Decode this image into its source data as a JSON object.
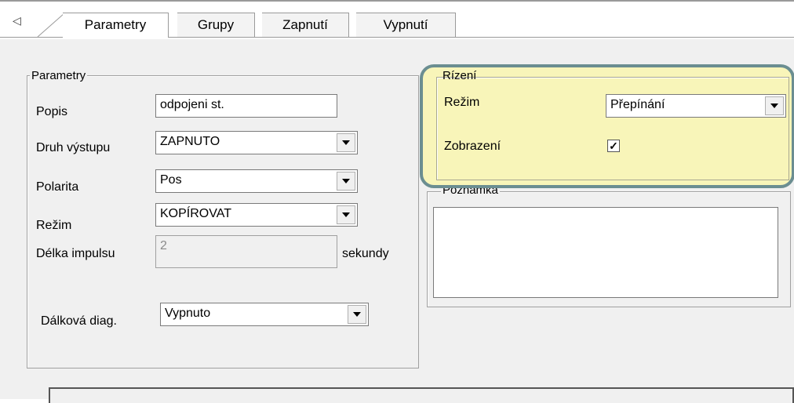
{
  "tabs": [
    {
      "label": "Parametry",
      "active": true
    },
    {
      "label": "Grupy",
      "active": false
    },
    {
      "label": "Zapnutí",
      "active": false
    },
    {
      "label": "Vypnutí",
      "active": false
    }
  ],
  "parametry": {
    "legend": "Parametry",
    "popis_label": "Popis",
    "popis_value": "odpojeni st.",
    "druh_label": "Druh výstupu",
    "druh_value": "ZAPNUTO",
    "polarita_label": "Polarita",
    "polarita_value": "Pos",
    "rezim_label": "Režim",
    "rezim_value": "KOPÍROVAT",
    "delka_label": "Délka impulsu",
    "delka_value": "2",
    "delka_unit": "sekundy",
    "dalkova_label": "Dálková diag.",
    "dalkova_value": "Vypnuto"
  },
  "rizeni": {
    "legend": "Rízení",
    "rezim_label": "Režim",
    "rezim_value": "Přepínání",
    "zobrazeni_label": "Zobrazení",
    "zobrazeni_checked": true
  },
  "poznamka": {
    "legend": "Poznámka",
    "value": ""
  },
  "colors": {
    "highlight_fill": "#fffa8c",
    "highlight_border": "#6b8e91"
  }
}
